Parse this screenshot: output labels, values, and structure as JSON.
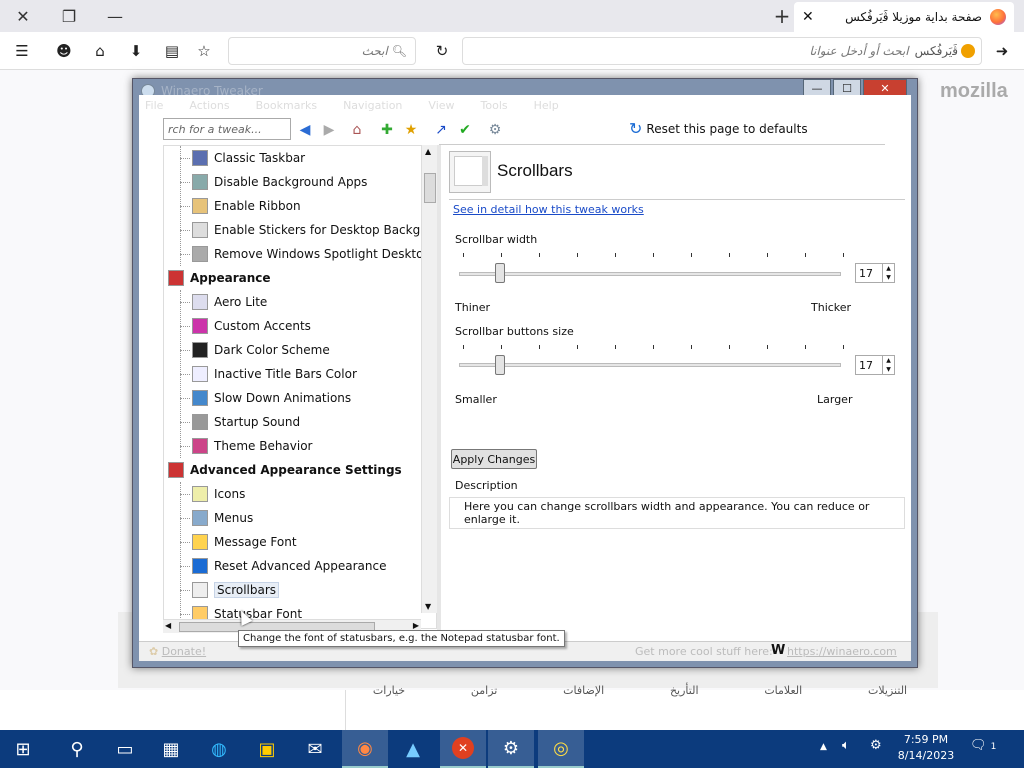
{
  "browser": {
    "tab_title": "صفحة بداية موزيلا ﭬَيَرفُكس",
    "search_placeholder": "ابحث",
    "url_brand": "ﭬَيَرفُكس",
    "url_placeholder": "ابحث أو أدخل عنوانا",
    "page_logo": "mozilla",
    "bottom_links": [
      "التنزيلات",
      "العلامات",
      "التأريخ",
      "الإضافات",
      "تزامن",
      "خيارات"
    ]
  },
  "app": {
    "title": "Winaero Tweaker",
    "menu": [
      "File",
      "Actions",
      "Bookmarks",
      "Navigation",
      "View",
      "Tools",
      "Help"
    ],
    "search_placeholder": "rch for a tweak...",
    "reset_label": "Reset this page to defaults",
    "tree": {
      "items": [
        {
          "label": "Classic Taskbar",
          "type": "child"
        },
        {
          "label": "Disable Background Apps",
          "type": "child"
        },
        {
          "label": "Enable Ribbon",
          "type": "child"
        },
        {
          "label": "Enable Stickers for Desktop Background",
          "type": "child"
        },
        {
          "label": "Remove Windows Spotlight Desktop Icon",
          "type": "child"
        },
        {
          "label": "Appearance",
          "type": "category"
        },
        {
          "label": "Aero Lite",
          "type": "child"
        },
        {
          "label": "Custom Accents",
          "type": "child"
        },
        {
          "label": "Dark Color Scheme",
          "type": "child"
        },
        {
          "label": "Inactive Title Bars Color",
          "type": "child"
        },
        {
          "label": "Slow Down Animations",
          "type": "child"
        },
        {
          "label": "Startup Sound",
          "type": "child"
        },
        {
          "label": "Theme Behavior",
          "type": "child"
        },
        {
          "label": "Advanced Appearance Settings",
          "type": "category"
        },
        {
          "label": "Icons",
          "type": "child"
        },
        {
          "label": "Menus",
          "type": "child"
        },
        {
          "label": "Message Font",
          "type": "child"
        },
        {
          "label": "Reset Advanced Appearance",
          "type": "child"
        },
        {
          "label": "Scrollbars",
          "type": "child",
          "selected": true
        },
        {
          "label": "Statusbar Font",
          "type": "child"
        }
      ]
    },
    "panel": {
      "title": "Scrollbars",
      "detail_link": "See in detail how this tweak works",
      "width_label": "Scrollbar width",
      "width_value": "17",
      "width_min_label": "Thiner",
      "width_max_label": "Thicker",
      "buttons_label": "Scrollbar buttons size",
      "buttons_value": "17",
      "buttons_min_label": "Smaller",
      "buttons_max_label": "Larger",
      "apply_label": "Apply Changes",
      "description_heading": "Description",
      "description": "Here you can change scrollbars width and appearance. You can reduce or enlarge it."
    },
    "status": {
      "donate": "Donate!",
      "cool_stuff": "Get more cool stuff here:",
      "link": "https://winaero.com"
    },
    "tooltip": "Change the font of statusbars, e.g. the Notepad statusbar font."
  },
  "taskbar": {
    "time": "7:59 PM",
    "date": "8/14/2023",
    "notification_count": "1"
  }
}
